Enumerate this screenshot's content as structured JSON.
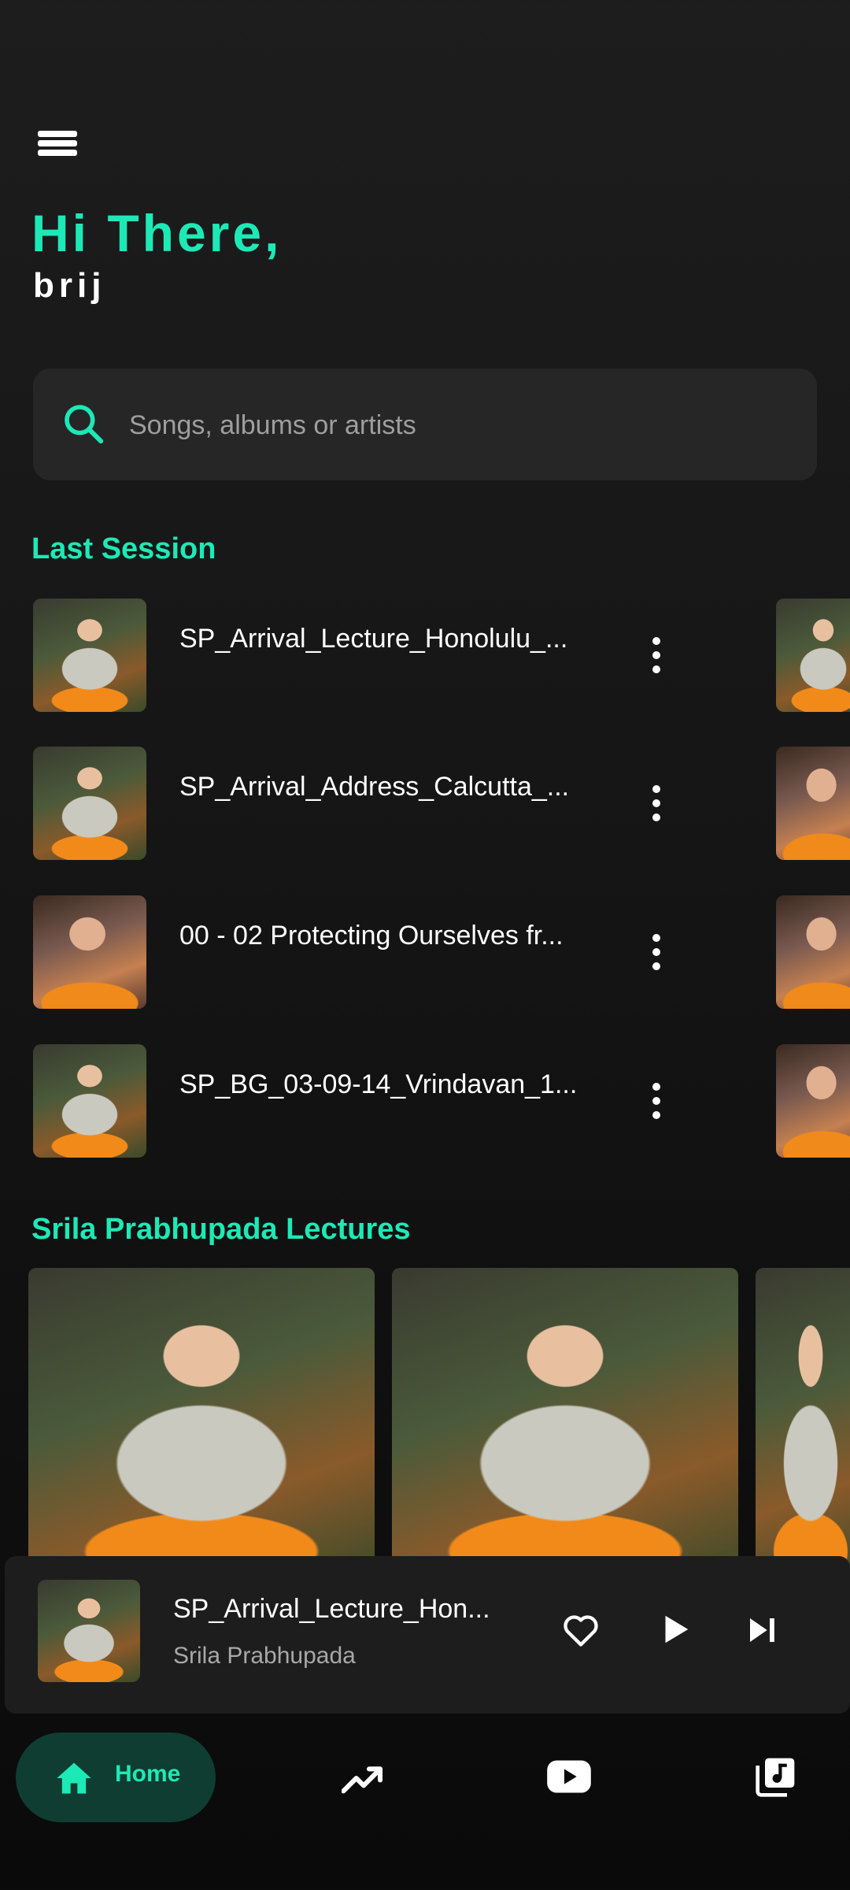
{
  "header": {
    "greeting": "Hi There,",
    "username": "brij"
  },
  "search": {
    "placeholder": "Songs, albums or artists"
  },
  "last_session": {
    "title": "Last Session",
    "items": [
      {
        "title": "SP_Arrival_Lecture_Honolulu_..."
      },
      {
        "title": "SP_Arrival_Address_Calcutta_..."
      },
      {
        "title": "00 - 02 Protecting Ourselves fr..."
      },
      {
        "title": "SP_BG_03-09-14_Vrindavan_1..."
      }
    ]
  },
  "lectures": {
    "title": "Srila Prabhupada Lectures"
  },
  "now_playing": {
    "title": "SP_Arrival_Lecture_Hon...",
    "artist": "Srila Prabhupada"
  },
  "bottom_nav": {
    "home_label": "Home"
  },
  "colors": {
    "accent": "#1de9b6",
    "background": "#1d1d1d",
    "card": "#262626",
    "home_pill": "#0f3d31"
  },
  "icons": [
    "menu-icon",
    "search-icon",
    "more-vert-icon",
    "heart-icon",
    "play-icon",
    "skip-next-icon",
    "home-icon",
    "trending-icon",
    "youtube-icon",
    "library-music-icon"
  ]
}
